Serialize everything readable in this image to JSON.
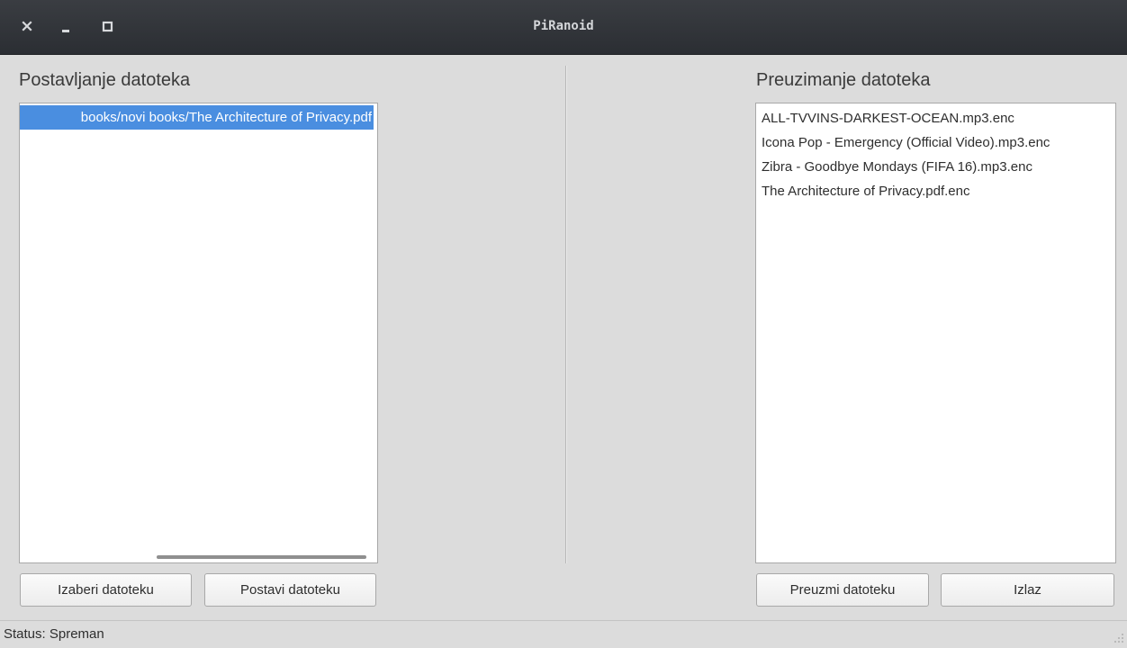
{
  "window": {
    "title": "PiRanoid",
    "controls": [
      "close-icon",
      "minimize-icon",
      "maximize-icon"
    ]
  },
  "upload": {
    "title": "Postavljanje datoteka",
    "files": [
      "books/novi books/The Architecture of Privacy.pdf"
    ],
    "choose_button": "Izaberi datoteku",
    "upload_button": "Postavi datoteku"
  },
  "download": {
    "title": "Preuzimanje datoteka",
    "files": [
      "ALL-TVVINS-DARKEST-OCEAN.mp3.enc",
      "Icona Pop - Emergency (Official Video).mp3.enc",
      "Zibra - Goodbye Mondays (FIFA 16).mp3.enc",
      "The Architecture of Privacy.pdf.enc"
    ],
    "download_button": "Preuzmi datoteku",
    "exit_button": "Izlaz"
  },
  "status": {
    "text": "Status: Spreman"
  },
  "colors": {
    "selection": "#4a8ee0",
    "titlebar": "#2f3237",
    "background": "#dcdcdc"
  }
}
